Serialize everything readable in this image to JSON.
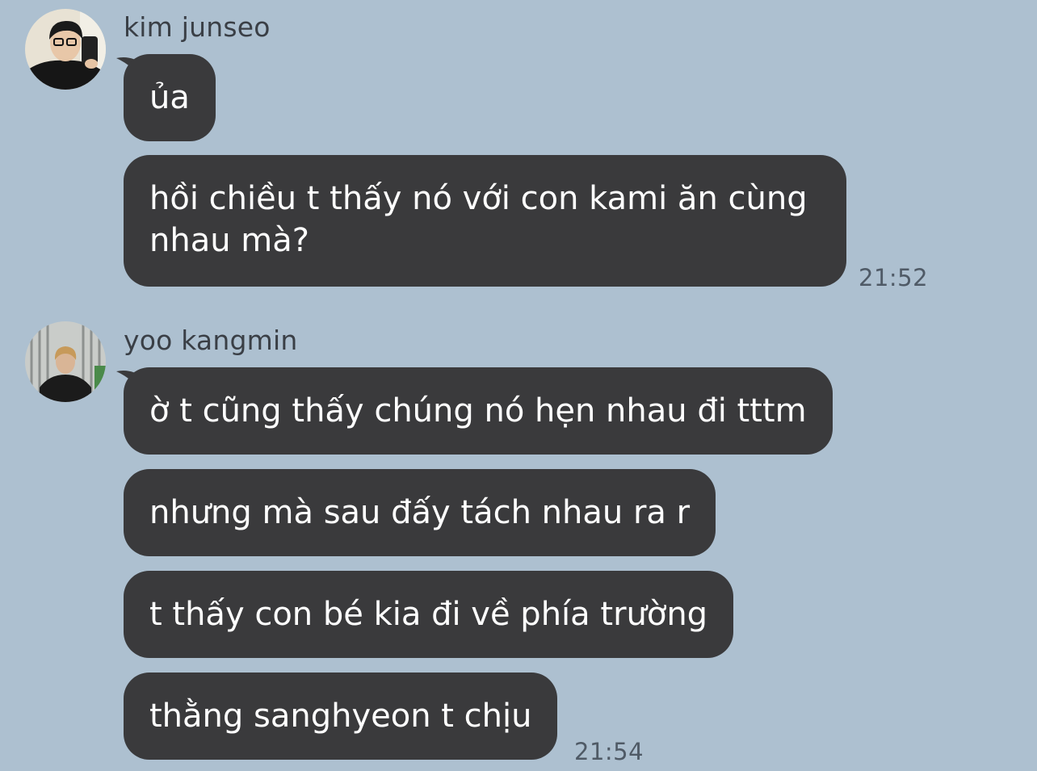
{
  "chat": {
    "group1": {
      "sender": "kim junseo",
      "messages": [
        "ủa",
        "hồi chiều t thấy nó với con kami ăn cùng nhau mà?"
      ],
      "time": "21:52"
    },
    "group2": {
      "sender": "yoo kangmin",
      "messages": [
        "ờ t cũng thấy chúng nó hẹn nhau đi tttm",
        "nhưng mà sau đấy tách nhau ra r",
        "t thấy con bé kia đi về phía trường",
        "thằng sanghyeon t chịu"
      ],
      "time": "21:54"
    }
  },
  "colors": {
    "background": "#adc0d0",
    "bubble": "#3a3a3c",
    "bubble_text": "#ffffff"
  },
  "icons": {
    "avatar1": "profile-photo",
    "avatar2": "profile-photo"
  }
}
